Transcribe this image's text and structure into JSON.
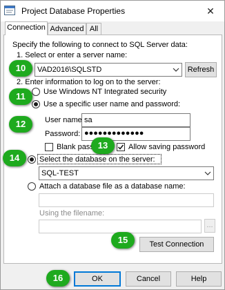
{
  "window": {
    "title": "Project Database Properties",
    "close_glyph": "✕"
  },
  "tabs": [
    {
      "label": "Connection"
    },
    {
      "label": "Advanced"
    },
    {
      "label": "All"
    }
  ],
  "connection": {
    "intro": "Specify the following to connect to SQL Server data:",
    "step1_label": "1. Select or enter a server name:",
    "server_value": "VAD2016\\SQLSTD",
    "refresh_label": "Refresh",
    "step2_label": "2. Enter information to log on to the server:",
    "radio_windows_auth": "Use Windows NT Integrated security",
    "radio_sql_auth": "Use a specific user name and password:",
    "user_name_label": "User name:",
    "user_name_value": "sa",
    "password_label": "Password:",
    "password_value": "●●●●●●●●●●●●●",
    "blank_password_label": "Blank passw",
    "allow_saving_label": "Allow saving password",
    "select_db_label": "Select the database on the server:",
    "database_value": "SQL-TEST",
    "attach_db_label": "Attach a database file as a database name:",
    "filename_label": "Using the filename:",
    "browse_label": "...",
    "test_connection_label": "Test Connection"
  },
  "footer": {
    "ok_label": "OK",
    "cancel_label": "Cancel",
    "help_label": "Help"
  },
  "badges": {
    "b10": "10",
    "b11": "11",
    "b12": "12",
    "b13": "13",
    "b14": "14",
    "b15": "15",
    "b16": "16"
  },
  "colors": {
    "badge_green": "#1eaa1e",
    "focus_blue": "#0078d7"
  }
}
